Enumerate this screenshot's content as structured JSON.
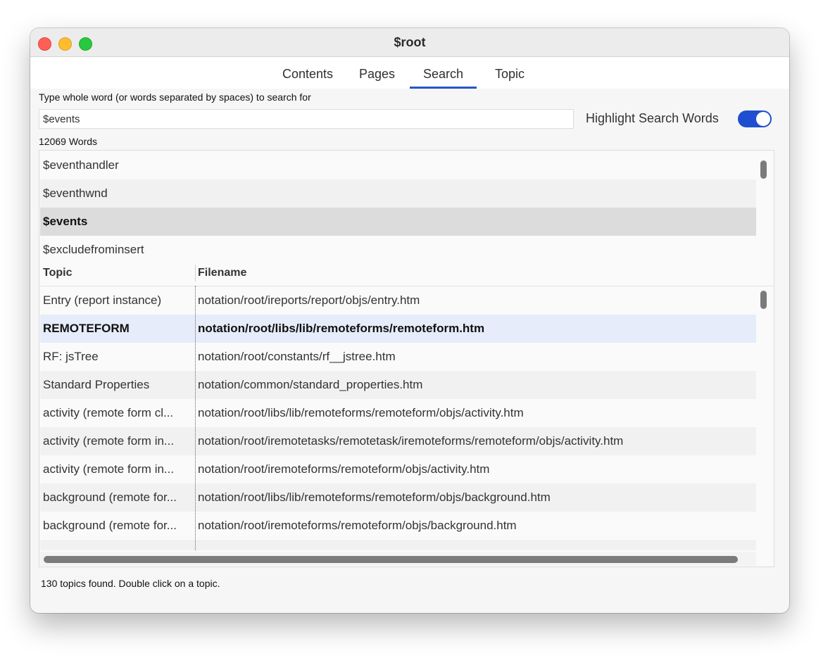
{
  "window": {
    "title": "$root"
  },
  "tabs": [
    "Contents",
    "Pages",
    "Search",
    "Topic"
  ],
  "active_tab": "Search",
  "search": {
    "prompt": "Type whole word (or words separated by spaces) to search for",
    "value": "$events",
    "highlight_label": "Highlight Search Words",
    "highlight_on": true,
    "word_count": "12069 Words"
  },
  "words": [
    "$eventhandler",
    "$eventhwnd",
    "$events",
    "$excludefrominsert"
  ],
  "selected_word": 2,
  "results": {
    "columns": [
      "Topic",
      "Filename"
    ],
    "selected_row": 1,
    "rows": [
      [
        "Entry (report instance)",
        "notation/root/ireports/report/objs/entry.htm"
      ],
      [
        "REMOTEFORM",
        "notation/root/libs/lib/remoteforms/remoteform.htm"
      ],
      [
        "RF: jsTree",
        "notation/root/constants/rf__jstree.htm"
      ],
      [
        "Standard Properties",
        "notation/common/standard_properties.htm"
      ],
      [
        "activity (remote form cl...",
        "notation/root/libs/lib/remoteforms/remoteform/objs/activity.htm"
      ],
      [
        "activity (remote form in...",
        "notation/root/iremotetasks/remotetask/iremoteforms/remoteform/objs/activity.htm"
      ],
      [
        "activity (remote form in...",
        "notation/root/iremoteforms/remoteform/objs/activity.htm"
      ],
      [
        "background (remote for...",
        "notation/root/libs/lib/remoteforms/remoteform/objs/background.htm"
      ],
      [
        "background (remote for...",
        "notation/root/iremoteforms/remoteform/objs/background.htm"
      ]
    ]
  },
  "status": "130 topics found. Double click on a topic.",
  "colors": {
    "accent": "#1f4fd0",
    "tab_underline": "#2457c8",
    "selected_word_bg": "#dcdcdc",
    "selected_row_bg": "#e6ecf9"
  }
}
